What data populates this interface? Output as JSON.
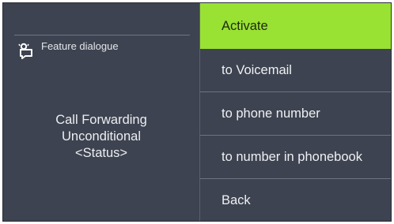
{
  "header": {
    "title": "Feature dialogue",
    "icon": "feature-dialogue-icon"
  },
  "status": {
    "line1": "Call Forwarding",
    "line2": "Unconditional",
    "line3": "<Status>"
  },
  "menu": {
    "items": [
      {
        "label": "Activate",
        "selected": true
      },
      {
        "label": "to Voicemail",
        "selected": false
      },
      {
        "label": "to phone number",
        "selected": false
      },
      {
        "label": "to number in phonebook",
        "selected": false
      },
      {
        "label": "Back",
        "selected": false
      }
    ]
  },
  "colors": {
    "background": "#3d4350",
    "highlight": "#99e133",
    "text": "#eef0f3"
  }
}
